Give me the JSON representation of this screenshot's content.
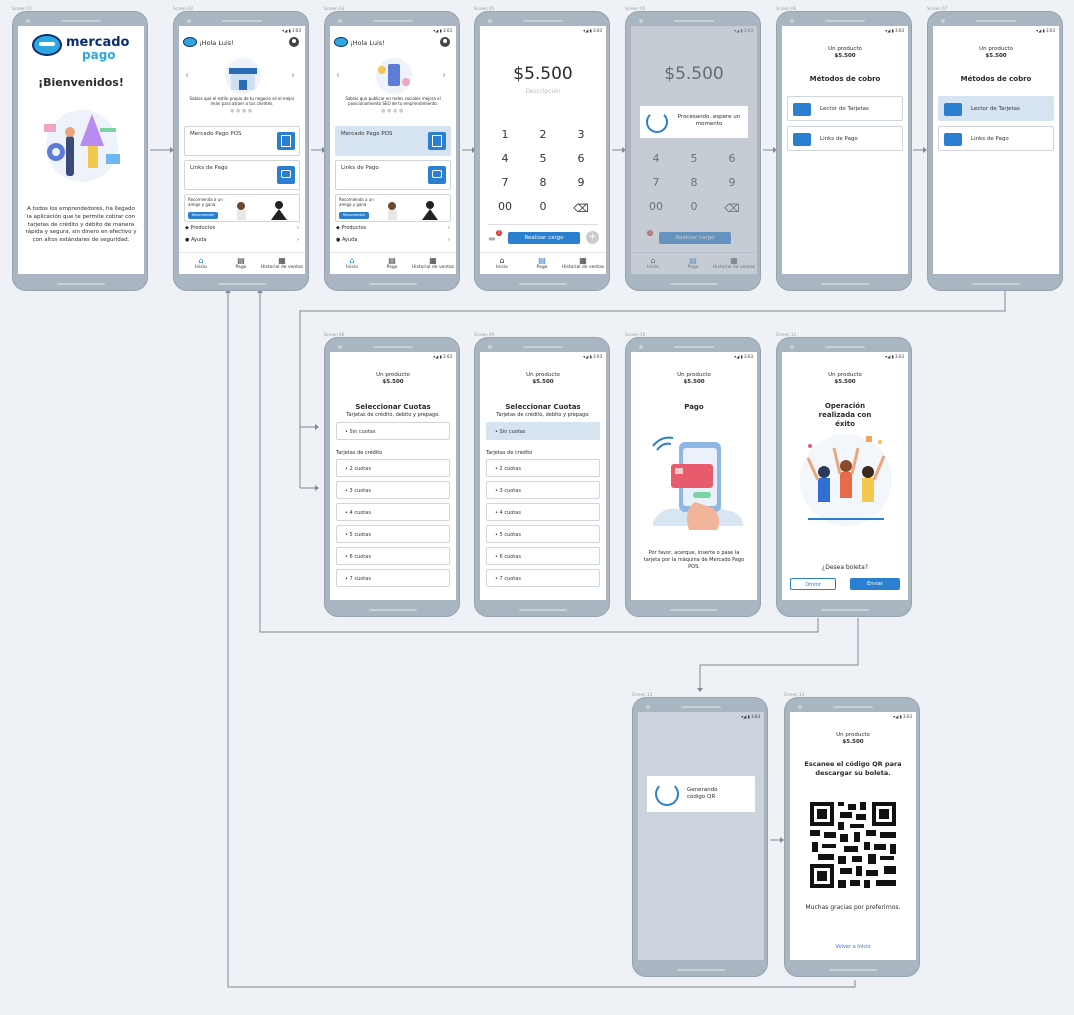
{
  "screen_labels": [
    "Screen 01",
    "Screen 02",
    "Screen 03",
    "Screen 05",
    "Screen 05",
    "Screen 06",
    "Screen 07",
    "Screen 08",
    "Screen 09",
    "Screen 10",
    "Screen 11",
    "Screen 12",
    "Screen 13"
  ],
  "status_time": "3:03",
  "s01": {
    "brand_top": "mercado",
    "brand_bottom": "pago",
    "welcome": "¡Bienvenidos!",
    "body": "A todos los emprendedores, ha llegado la aplicación que te permite cobrar con tarjetas de crédito y débito de manera rápida y segura, sin dinero en efectivo y con altos estándares de seguridad."
  },
  "home": {
    "greeting": "¡Hola Luis!",
    "s02_tip": "Sabías que el estilo propio de tu negocio es el mejor imán para atraer a tus clientes.",
    "s03_tip": "Sabías que publicar en redes sociales mejora el posicionamiento SEO de tu emprendimiento.",
    "pos": "Mercado Pago POS",
    "links": "Links de Pago",
    "recommend_text": "Recomienda a un amigo y gana",
    "recommend_btn": "Recomendar",
    "productos": "Productos",
    "ayuda": "Ayuda",
    "nav": [
      "Inicio",
      "Pago",
      "Historial de ventas"
    ]
  },
  "pay": {
    "amount": "$5.500",
    "desc": "Descripción",
    "keys": [
      "1",
      "2",
      "3",
      "4",
      "5",
      "6",
      "7",
      "8",
      "9",
      "00",
      "0"
    ],
    "charge": "Realizar cargo",
    "badge": "1",
    "processing": "Procesando, espere un momento"
  },
  "methods": {
    "product": "Un producto",
    "price": "$5.500",
    "title": "Métodos de cobro",
    "reader": "Lector de Tarjetas",
    "links": "Links de Pago"
  },
  "cuotas": {
    "title": "Seleccionar Cuotas",
    "subtitle": "Tarjetas de crédito, debito y prepago.",
    "sin": "Sin cuotas",
    "credit": "Tarjetas de crédito",
    "opts": [
      "2 cuotas",
      "3 cuotas",
      "4 cuotas",
      "5 cuotas",
      "6 cuotas",
      "7 cuotas"
    ]
  },
  "pago": {
    "title": "Pago",
    "text": "Por favor, acerque, inserte o pase la tarjeta por la máquina de Mercado Pago POS."
  },
  "success": {
    "title": "Operación realizada con éxito",
    "question": "¿Desea boleta?",
    "omit": "Omitir",
    "send": "Enviar"
  },
  "qrgen": {
    "text": "Generando código QR"
  },
  "qr": {
    "title": "Escanee el código QR para descargar su boleta.",
    "thanks": "Muchas gracias por preferirnos.",
    "back": "Volver a Inicio"
  },
  "colors": {
    "accent": "#2a7fd0",
    "frame": "#a9b5c1",
    "selected": "#d6e4f2",
    "navy": "#0a2d6e"
  }
}
